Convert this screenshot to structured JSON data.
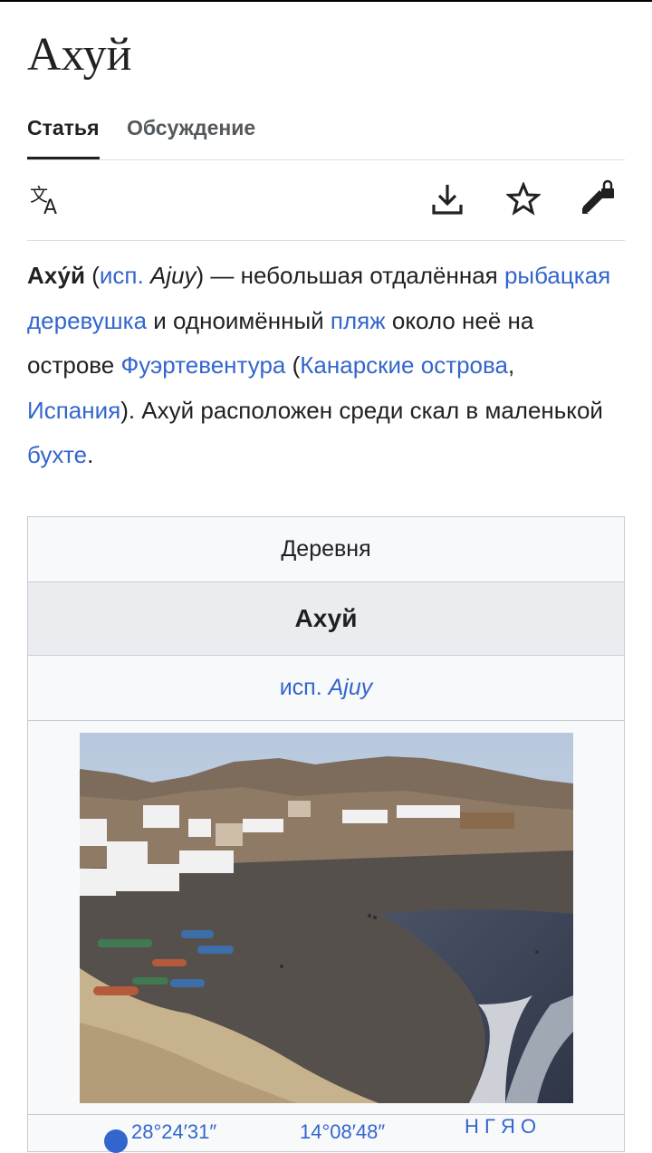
{
  "page": {
    "title": "Ахуй"
  },
  "tabs": [
    {
      "label": "Статья",
      "active": true
    },
    {
      "label": "Обсуждение",
      "active": false
    }
  ],
  "toolbar": {
    "icons": [
      "translate-icon",
      "download-icon",
      "star-icon",
      "edit-lock-icon"
    ]
  },
  "lead": {
    "name": "Аху́й",
    "open_paren": " (",
    "lang_link": "исп.",
    "sp": " ",
    "native": "Ajuy",
    "after_native": ") — небольшая отдалённая ",
    "link_village": "рыбацкая деревушка",
    "text2": " и одноимённый ",
    "link_beach": "пляж",
    "text3": " около неё на острове ",
    "link_island": "Фуэртевентура",
    "text4": " (",
    "link_canary": "Канарские острова",
    "comma": ", ",
    "link_spain": "Испания",
    "text5": "). Ахуй расположен среди скал в маленькой ",
    "link_bay": "бухте",
    "end": "."
  },
  "infobox": {
    "type": "Деревня",
    "name": "Ахуй",
    "orig_lang": "исп.",
    "orig_name": "Ajuy",
    "coords_lat": "28°24′31″",
    "coords_lon": "14°08′48″",
    "coords_lang": "Н Г Я О"
  },
  "colors": {
    "link": "#3366cc",
    "text": "#202122",
    "border": "#c8ccd1"
  }
}
